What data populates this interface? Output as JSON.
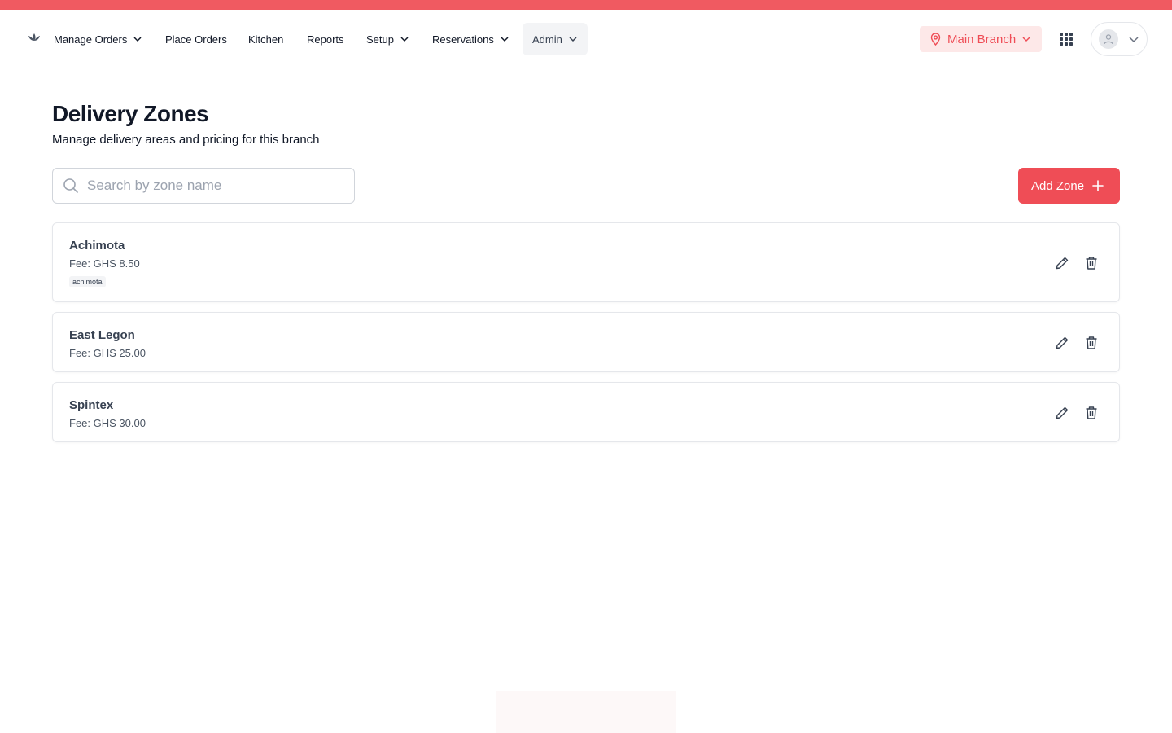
{
  "nav": {
    "items": [
      {
        "label": "Manage Orders",
        "dropdown": true
      },
      {
        "label": "Place Orders",
        "dropdown": false
      },
      {
        "label": "Kitchen",
        "dropdown": false
      },
      {
        "label": "Reports",
        "dropdown": false
      },
      {
        "label": "Setup",
        "dropdown": true
      },
      {
        "label": "Reservations",
        "dropdown": true
      },
      {
        "label": "Admin",
        "dropdown": true,
        "active": true
      }
    ],
    "branch": "Main Branch",
    "icons": {
      "logo": "lotus-logo-icon",
      "branch": "map-pin-icon",
      "apps": "grid-icon",
      "user": "user-icon"
    }
  },
  "page": {
    "title": "Delivery Zones",
    "subtitle": "Manage delivery areas and pricing for this branch"
  },
  "search": {
    "placeholder": "Search by zone name",
    "value": ""
  },
  "add_button": {
    "label": "Add Zone"
  },
  "zones": [
    {
      "name": "Achimota",
      "fee": "Fee: GHS 8.50",
      "tags": [
        "achimota"
      ]
    },
    {
      "name": "East Legon",
      "fee": "Fee: GHS 25.00",
      "tags": []
    },
    {
      "name": "Spintex",
      "fee": "Fee: GHS 30.00",
      "tags": []
    }
  ],
  "colors": {
    "accent": "#f05a61",
    "button": "#ef4d56",
    "branch_bg": "#fde8e8"
  }
}
